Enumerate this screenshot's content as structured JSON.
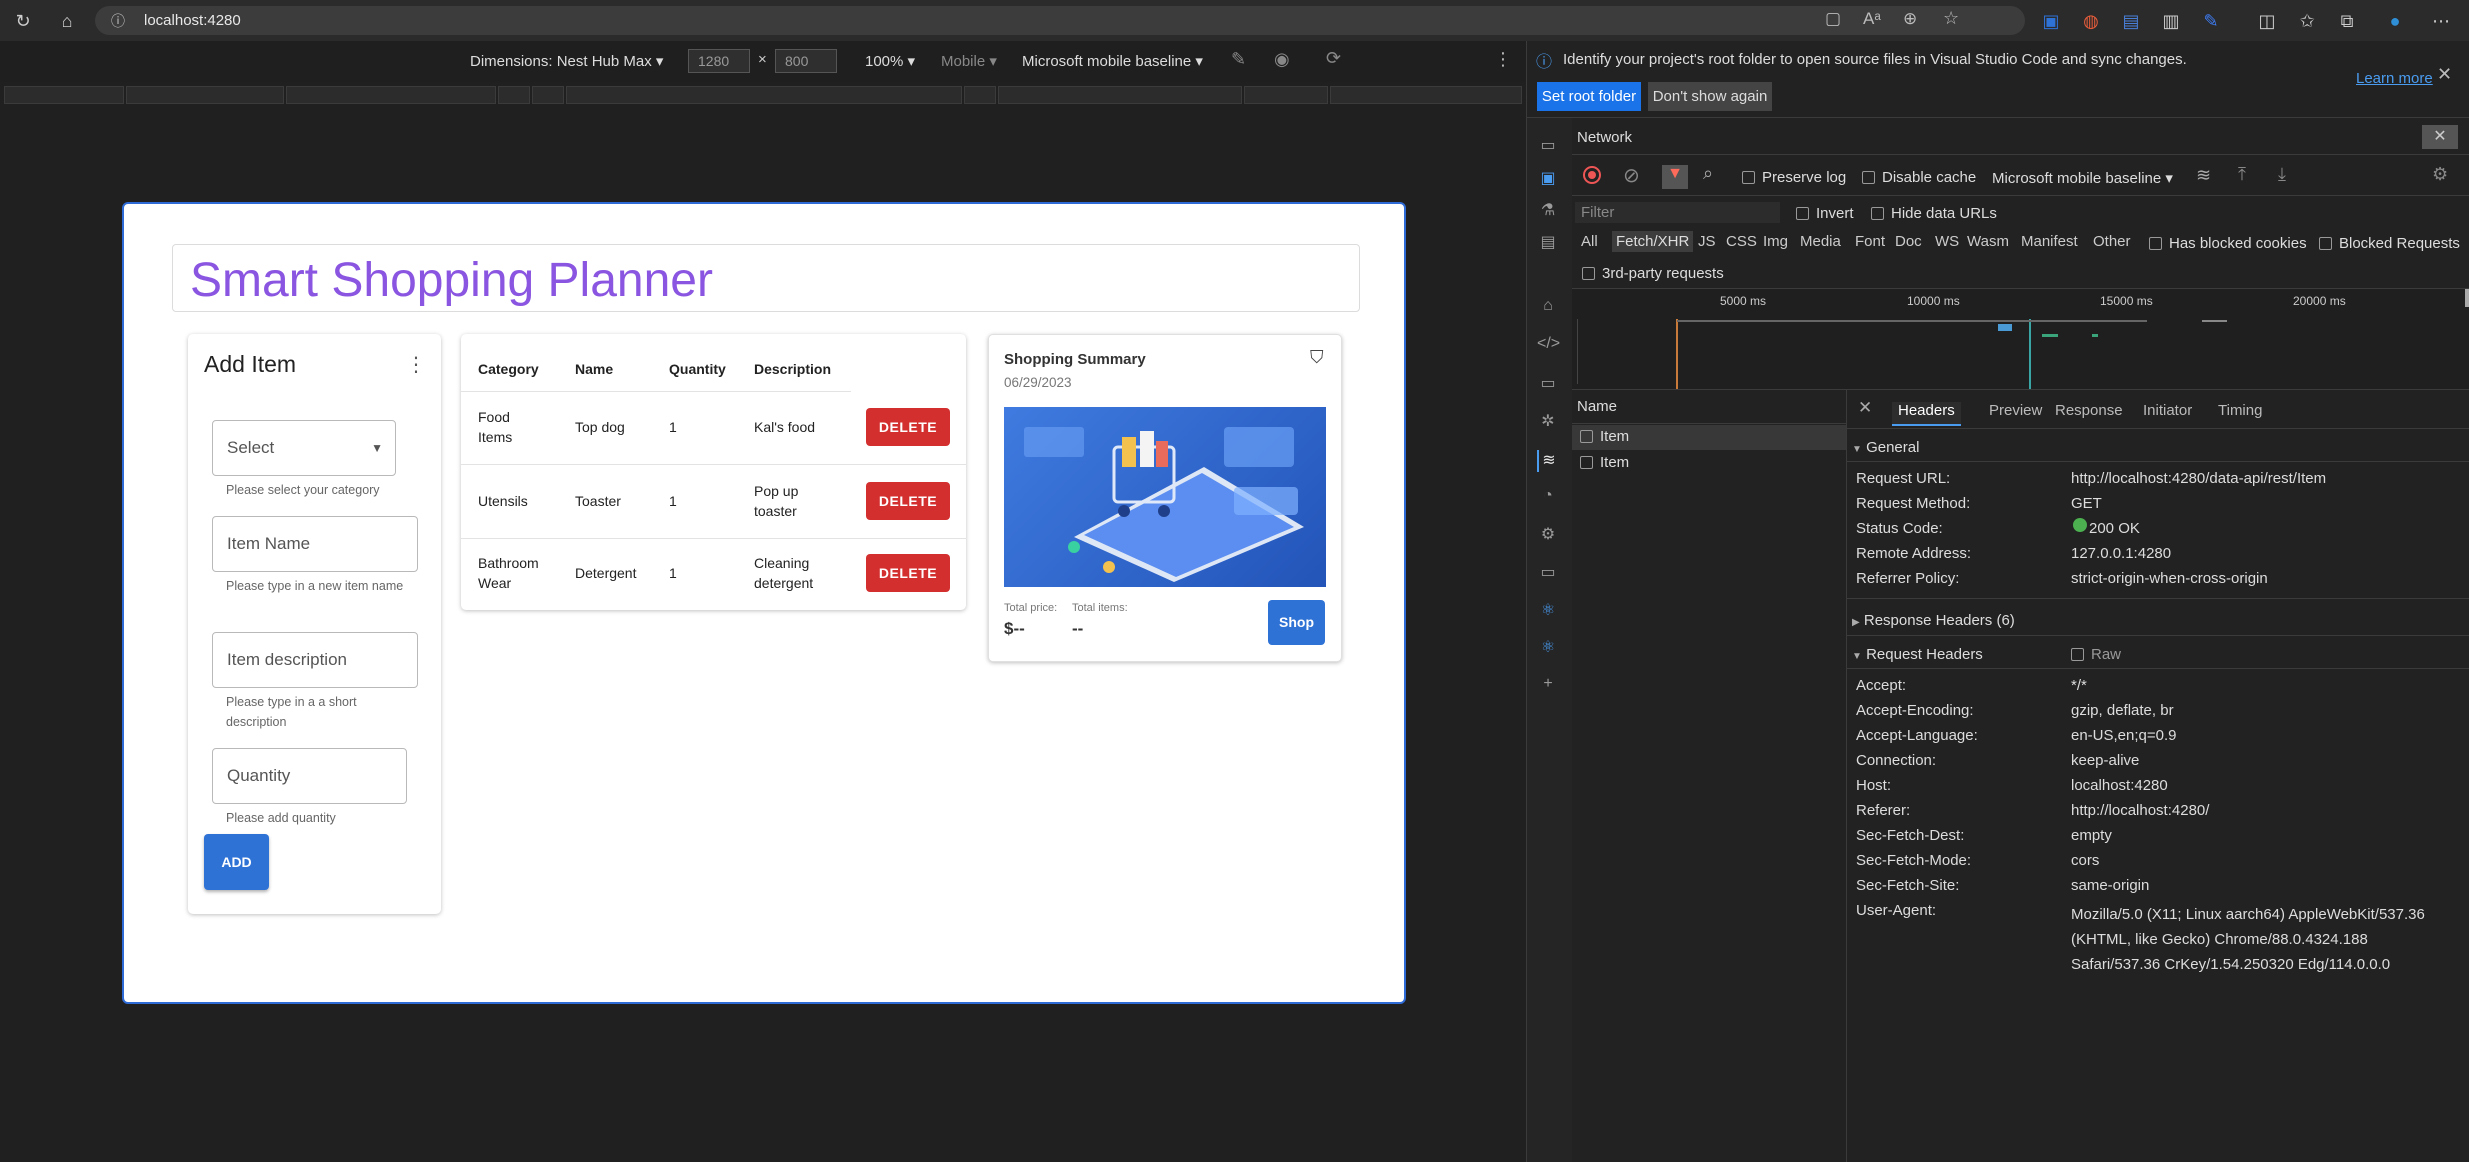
{
  "browser": {
    "url": "localhost:4280"
  },
  "devtoolbar": {
    "dimensions_label": "Dimensions: Nest Hub Max",
    "width": "1280",
    "times": "×",
    "height": "800",
    "zoom": "100%",
    "device_type": "Mobile",
    "throttle": "Microsoft mobile baseline"
  },
  "app": {
    "title": "Smart Shopping Planner",
    "add_item": {
      "title": "Add Item",
      "category_placeholder": "Select",
      "category_help": "Please select your category",
      "name_placeholder": "Item Name",
      "name_help": "Please type in a new item name",
      "desc_placeholder": "Item description",
      "desc_help": "Please type in a a short description",
      "qty_placeholder": "Quantity",
      "qty_help": "Please add quantity",
      "add_label": "ADD"
    },
    "table": {
      "headers": [
        "Category",
        "Name",
        "Quantity",
        "Description"
      ],
      "delete_label": "DELETE",
      "rows": [
        {
          "category": "Food Items",
          "name": "Top dog",
          "quantity": "1",
          "description": "Kal's food"
        },
        {
          "category": "Utensils",
          "name": "Toaster",
          "quantity": "1",
          "description": "Pop up toaster"
        },
        {
          "category": "Bathroom Wear",
          "name": "Detergent",
          "quantity": "1",
          "description": "Cleaning detergent"
        }
      ]
    },
    "summary": {
      "title": "Shopping Summary",
      "date": "06/29/2023",
      "total_price_label": "Total price:",
      "total_price": "$--",
      "total_items_label": "Total items:",
      "total_items": "--",
      "shop_label": "Shop"
    }
  },
  "devtools": {
    "notice": "Identify your project's root folder to open source files in Visual Studio Code and sync changes.",
    "learn_more": "Learn more",
    "set_root": "Set root folder",
    "dont_show": "Don't show again",
    "panel_title": "Network",
    "toolbar": {
      "preserve_log": "Preserve log",
      "disable_cache": "Disable cache",
      "throttle": "Microsoft mobile baseline"
    },
    "filter_placeholder": "Filter",
    "invert": "Invert",
    "hide_data_urls": "Hide data URLs",
    "type_filters": [
      "All",
      "Fetch/XHR",
      "JS",
      "CSS",
      "Img",
      "Media",
      "Font",
      "Doc",
      "WS",
      "Wasm",
      "Manifest",
      "Other"
    ],
    "has_blocked_cookies": "Has blocked cookies",
    "blocked_requests": "Blocked Requests",
    "third_party": "3rd-party requests",
    "timeline_ticks": [
      "5000 ms",
      "10000 ms",
      "15000 ms",
      "20000 ms"
    ],
    "name_header": "Name",
    "requests": [
      "Item",
      "Item"
    ],
    "detail_tabs": [
      "Headers",
      "Preview",
      "Response",
      "Initiator",
      "Timing"
    ],
    "general_label": "General",
    "general": [
      {
        "k": "Request URL:",
        "v": "http://localhost:4280/data-api/rest/Item"
      },
      {
        "k": "Request Method:",
        "v": "GET"
      },
      {
        "k": "Status Code:",
        "v": "200 OK"
      },
      {
        "k": "Remote Address:",
        "v": "127.0.0.1:4280"
      },
      {
        "k": "Referrer Policy:",
        "v": "strict-origin-when-cross-origin"
      }
    ],
    "response_headers_label": "Response Headers (6)",
    "request_headers_label": "Request Headers",
    "raw_label": "Raw",
    "request_headers": [
      {
        "k": "Accept:",
        "v": "*/*"
      },
      {
        "k": "Accept-Encoding:",
        "v": "gzip, deflate, br"
      },
      {
        "k": "Accept-Language:",
        "v": "en-US,en;q=0.9"
      },
      {
        "k": "Connection:",
        "v": "keep-alive"
      },
      {
        "k": "Host:",
        "v": "localhost:4280"
      },
      {
        "k": "Referer:",
        "v": "http://localhost:4280/"
      },
      {
        "k": "Sec-Fetch-Dest:",
        "v": "empty"
      },
      {
        "k": "Sec-Fetch-Mode:",
        "v": "cors"
      },
      {
        "k": "Sec-Fetch-Site:",
        "v": "same-origin"
      },
      {
        "k": "User-Agent:",
        "v": "Mozilla/5.0 (X11; Linux aarch64) AppleWebKit/537.36 (KHTML, like Gecko) Chrome/88.0.4324.188 Safari/537.36 CrKey/1.54.250320 Edg/114.0.0.0"
      }
    ]
  },
  "colors": {
    "title": "#8a55e0",
    "delete": "#d32f2f",
    "button": "#2f72d6",
    "status_ok": "#4caf50"
  }
}
